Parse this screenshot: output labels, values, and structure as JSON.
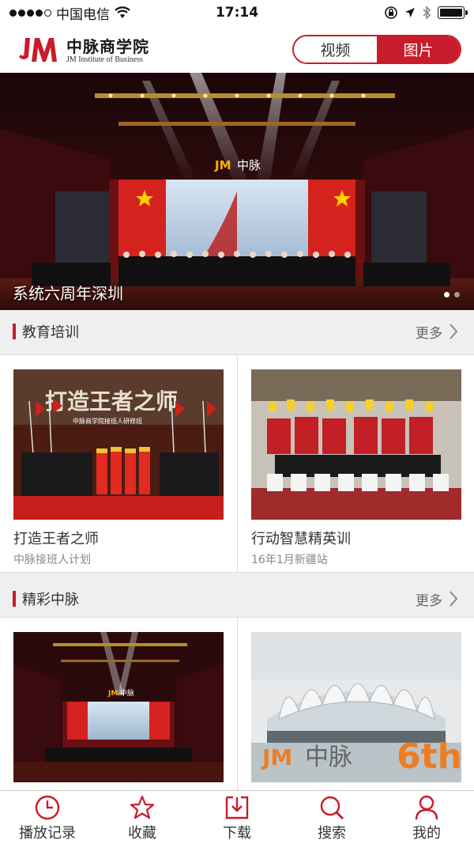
{
  "status_bar": {
    "carrier": "中国电信",
    "time": "17:14"
  },
  "header": {
    "logo_cn": "中脉商学院",
    "logo_en": "JM Institute of Business",
    "segment": {
      "video_label": "视频",
      "image_label": "图片",
      "selected": "图片"
    }
  },
  "banner": {
    "caption": "系统六周年深圳",
    "stage_sign": "中脉",
    "page_count": 2,
    "active_page": 1
  },
  "sections": [
    {
      "title": "教育培训",
      "more_label": "更多",
      "cards": [
        {
          "title": "打造王者之师",
          "subtitle": "中脉接班人计划",
          "banner_text": "打造王者之师",
          "banner_sub": "中脉商学院接班人研修班"
        },
        {
          "title": "行动智慧精英训",
          "subtitle": "16年1月新疆站"
        }
      ]
    },
    {
      "title": "精彩中脉",
      "more_label": "更多",
      "cards": [
        {
          "stage_sign": "中脉"
        },
        {
          "sign_text": "中脉",
          "sign_number": "6th"
        }
      ]
    }
  ],
  "tab_bar": [
    {
      "label": "播放记录",
      "icon": "clock-icon"
    },
    {
      "label": "收藏",
      "icon": "star-icon"
    },
    {
      "label": "下载",
      "icon": "download-icon"
    },
    {
      "label": "搜索",
      "icon": "search-icon"
    },
    {
      "label": "我的",
      "icon": "user-icon"
    }
  ],
  "colors": {
    "brand_red": "#c81c2a"
  }
}
